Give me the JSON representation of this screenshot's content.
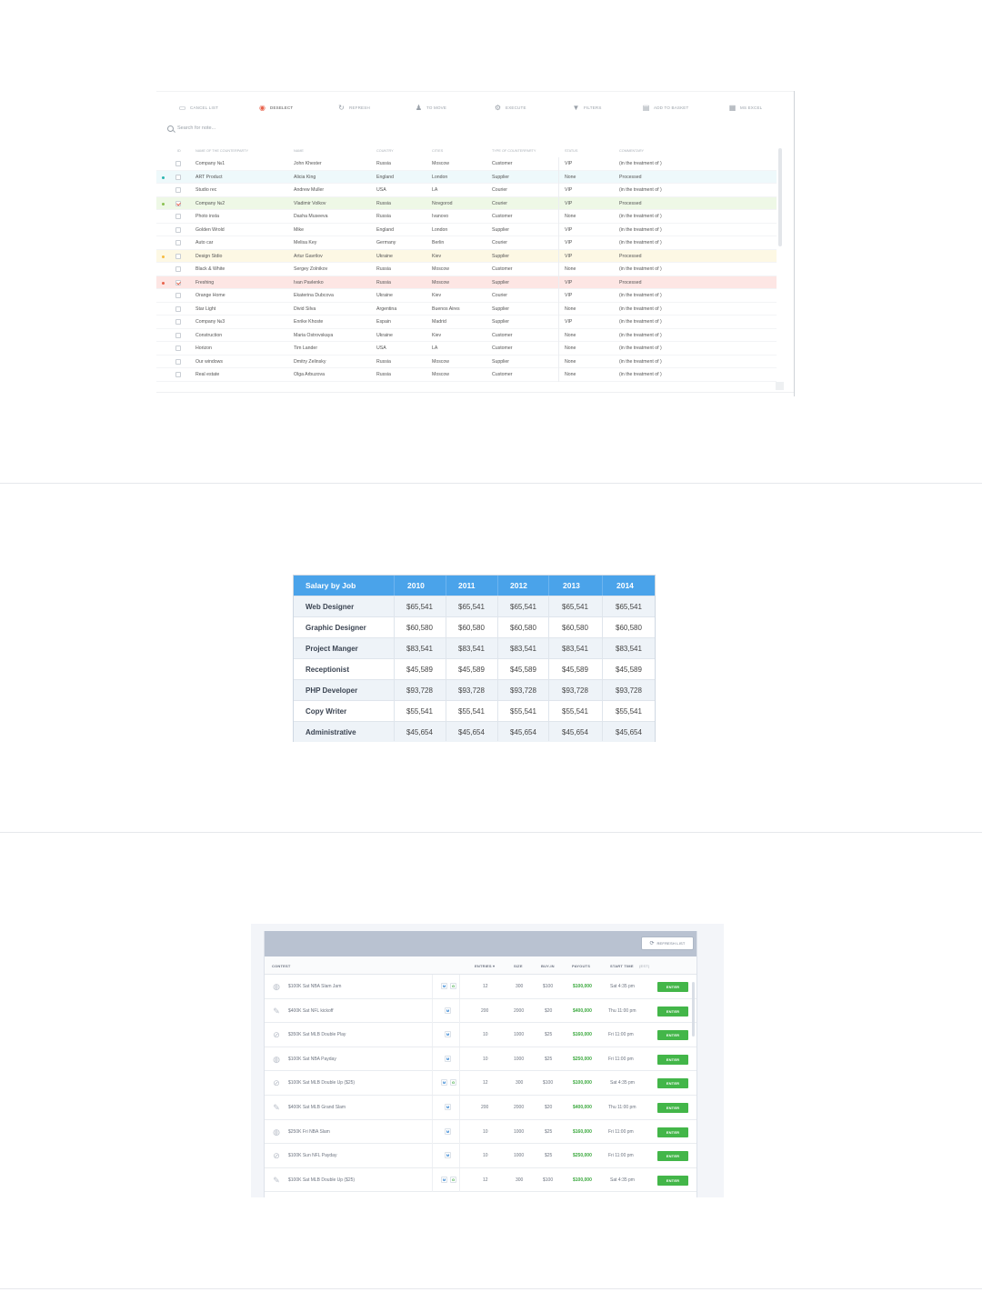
{
  "counterparties": {
    "toolbar": [
      {
        "icon": "document-icon",
        "label": "CANCEL LIST",
        "active": false
      },
      {
        "icon": "deselect-icon",
        "label": "DESELECT",
        "active": true
      },
      {
        "icon": "refresh-icon",
        "label": "REFRESH",
        "active": false
      },
      {
        "icon": "person-icon",
        "label": "TO MOVE",
        "active": false
      },
      {
        "icon": "gear-icon",
        "label": "EXECUTE",
        "active": false
      },
      {
        "icon": "filter-icon",
        "label": "FILTERS",
        "active": false
      },
      {
        "icon": "basket-icon",
        "label": "ADD TO BASKET",
        "active": false
      },
      {
        "icon": "excel-icon",
        "label": "MS EXCEL",
        "active": false
      }
    ],
    "search_placeholder": "Search for note...",
    "columns": [
      "ID",
      "NAME OF THE COUNTERPARTY",
      "NAME",
      "COUNTRY",
      "CITIES",
      "TYPE OF COUNTERPARTY",
      "STATUS",
      "COMMENTARY"
    ],
    "rows": [
      {
        "company": "Company №1",
        "name": "John Khester",
        "country": "Russia",
        "city": "Moscow",
        "type": "Customer",
        "status": "VIP",
        "comment": "(in the treatment of )",
        "checked": false,
        "marker": "",
        "highlight": ""
      },
      {
        "company": "ART Product",
        "name": "Alicia King",
        "country": "England",
        "city": "London",
        "type": "Supplier",
        "status": "None",
        "comment": "Processed",
        "checked": false,
        "marker": "#2bb5b0",
        "highlight": "#eef9fb"
      },
      {
        "company": "Studio rec",
        "name": "Andrew Muller",
        "country": "USA",
        "city": "LA",
        "type": "Courier",
        "status": "VIP",
        "comment": "(in the treatment of )",
        "checked": false,
        "marker": "",
        "highlight": ""
      },
      {
        "company": "Company №2",
        "name": "Vladimir Volkov",
        "country": "Russia",
        "city": "Novgorod",
        "type": "Courier",
        "status": "VIP",
        "comment": "Processed",
        "checked": true,
        "marker": "#8cc152",
        "highlight": "#eef8e6"
      },
      {
        "company": "Photo insta",
        "name": "Dasha Museeva",
        "country": "Russia",
        "city": "Ivanovo",
        "type": "Customer",
        "status": "None",
        "comment": "(in the treatment of )",
        "checked": false,
        "marker": "",
        "highlight": ""
      },
      {
        "company": "Golden Wrold",
        "name": "Mike",
        "country": "England",
        "city": "London",
        "type": "Supplier",
        "status": "VIP",
        "comment": "(in the treatment of )",
        "checked": false,
        "marker": "",
        "highlight": ""
      },
      {
        "company": "Auto car",
        "name": "Melisa Key",
        "country": "Germany",
        "city": "Berlin",
        "type": "Courier",
        "status": "VIP",
        "comment": "(in the treatment of )",
        "checked": false,
        "marker": "",
        "highlight": ""
      },
      {
        "company": "Design Stdio",
        "name": "Artur Gavrilov",
        "country": "Ukraine",
        "city": "Kiev",
        "type": "Supplier",
        "status": "VIP",
        "comment": "Processed",
        "checked": false,
        "marker": "#f6bb42",
        "highlight": "#fdf8e4"
      },
      {
        "company": "Black & White",
        "name": "Sergey Zolnikov",
        "country": "Russia",
        "city": "Moscow",
        "type": "Customer",
        "status": "None",
        "comment": "(in the treatment of )",
        "checked": false,
        "marker": "",
        "highlight": ""
      },
      {
        "company": "Freshing",
        "name": "Ivan Pavlenko",
        "country": "Russia",
        "city": "Moscow",
        "type": "Supplier",
        "status": "VIP",
        "comment": "Processed",
        "checked": true,
        "marker": "#e8624c",
        "highlight": "#fde6e4"
      },
      {
        "company": "Orange Home",
        "name": "Ekaterina Dubcova",
        "country": "Ukraine",
        "city": "Kiev",
        "type": "Courier",
        "status": "VIP",
        "comment": "(in the treatment of )",
        "checked": false,
        "marker": "",
        "highlight": ""
      },
      {
        "company": "Star Light",
        "name": "Divid Silva",
        "country": "Argentina",
        "city": "Buenos Aires",
        "type": "Supplier",
        "status": "None",
        "comment": "(in the treatment of )",
        "checked": false,
        "marker": "",
        "highlight": ""
      },
      {
        "company": "Company №3",
        "name": "Enrike Khoste",
        "country": "Espain",
        "city": "Madrid",
        "type": "Supplier",
        "status": "VIP",
        "comment": "(in the treatment of )",
        "checked": false,
        "marker": "",
        "highlight": ""
      },
      {
        "company": "Construction",
        "name": "Maria Ostrovskaya",
        "country": "Ukraine",
        "city": "Kiev",
        "type": "Customer",
        "status": "None",
        "comment": "(in the treatment of )",
        "checked": false,
        "marker": "",
        "highlight": ""
      },
      {
        "company": "Horizon",
        "name": "Tim Lander",
        "country": "USA",
        "city": "LA",
        "type": "Customer",
        "status": "None",
        "comment": "(in the treatment of )",
        "checked": false,
        "marker": "",
        "highlight": ""
      },
      {
        "company": "Our windows",
        "name": "Dmitry Zelinsky",
        "country": "Russia",
        "city": "Moscow",
        "type": "Supplier",
        "status": "None",
        "comment": "(in the treatment of )",
        "checked": false,
        "marker": "",
        "highlight": ""
      },
      {
        "company": "Real estate",
        "name": "Olga Arbuzova",
        "country": "Russia",
        "city": "Moscow",
        "type": "Customer",
        "status": "None",
        "comment": "(in the treatment of )",
        "checked": false,
        "marker": "",
        "highlight": ""
      }
    ]
  },
  "salary": {
    "header": "Salary by Job",
    "years": [
      "2010",
      "2011",
      "2012",
      "2013",
      "2014"
    ],
    "rows": [
      {
        "job": "Web Designer",
        "values": [
          "$65,541",
          "$65,541",
          "$65,541",
          "$65,541",
          "$65,541"
        ]
      },
      {
        "job": "Graphic Designer",
        "values": [
          "$60,580",
          "$60,580",
          "$60,580",
          "$60,580",
          "$60,580"
        ]
      },
      {
        "job": "Project Manger",
        "values": [
          "$83,541",
          "$83,541",
          "$83,541",
          "$83,541",
          "$83,541"
        ]
      },
      {
        "job": "Receptionist",
        "values": [
          "$45,589",
          "$45,589",
          "$45,589",
          "$45,589",
          "$45,589"
        ]
      },
      {
        "job": "PHP Developer",
        "values": [
          "$93,728",
          "$93,728",
          "$93,728",
          "$93,728",
          "$93,728"
        ]
      },
      {
        "job": "Copy Writer",
        "values": [
          "$55,541",
          "$55,541",
          "$55,541",
          "$55,541",
          "$55,541"
        ]
      },
      {
        "job": "Administrative",
        "values": [
          "$45,654",
          "$45,654",
          "$45,654",
          "$45,654",
          "$45,654"
        ]
      }
    ],
    "colors": {
      "header": "#4aa3ea",
      "stripe": "#eef3f8"
    }
  },
  "lobby": {
    "refresh_label": "REFRESH LIST",
    "columns": {
      "contest": "CONTEST",
      "entries": "ENTRIES ▾",
      "size": "SIZE",
      "buyin": "BUY-IN",
      "payouts": "PAYOUTS",
      "start": "START TIME",
      "tz": "(EST)"
    },
    "enter_label": "ENTER",
    "rows": [
      {
        "sport": "basketball-icon",
        "name": "$100K Sat NBA Slam Jam",
        "badges": [
          "M",
          "G"
        ],
        "entries": "12",
        "size": "300",
        "buyin": "$100",
        "payouts": "$100,000",
        "start": "Sat 4:35 pm"
      },
      {
        "sport": "football-icon",
        "name": "$400K Sat NFL kickoff",
        "badges": [
          "M"
        ],
        "entries": "200",
        "size": "2000",
        "buyin": "$20",
        "payouts": "$400,000",
        "start": "Thu 11:00 pm"
      },
      {
        "sport": "baseball-icon",
        "name": "$350K Sat MLB Double Play",
        "badges": [
          "M"
        ],
        "entries": "10",
        "size": "1000",
        "buyin": "$25",
        "payouts": "$160,000",
        "start": "Fri 11:00 pm"
      },
      {
        "sport": "basketball-icon",
        "name": "$100K Sat NBA Payday",
        "badges": [
          "M"
        ],
        "entries": "10",
        "size": "1000",
        "buyin": "$25",
        "payouts": "$250,000",
        "start": "Fri 11:00 pm"
      },
      {
        "sport": "baseball-icon",
        "name": "$100K Sat MLB Double Up ($25)",
        "badges": [
          "M",
          "G"
        ],
        "entries": "12",
        "size": "300",
        "buyin": "$100",
        "payouts": "$100,000",
        "start": "Sat 4:35 pm"
      },
      {
        "sport": "football-icon",
        "name": "$400K Sat MLB Grand Slam",
        "badges": [
          "M"
        ],
        "entries": "200",
        "size": "2000",
        "buyin": "$20",
        "payouts": "$400,000",
        "start": "Thu 11:00 pm"
      },
      {
        "sport": "basketball-icon",
        "name": "$250K Fri NBA Slam",
        "badges": [
          "M"
        ],
        "entries": "10",
        "size": "1000",
        "buyin": "$25",
        "payouts": "$160,000",
        "start": "Fri 11:00 pm"
      },
      {
        "sport": "baseball-icon",
        "name": "$100K Sun NFL Payday",
        "badges": [
          "M"
        ],
        "entries": "10",
        "size": "1000",
        "buyin": "$25",
        "payouts": "$250,000",
        "start": "Fri 11:00 pm"
      },
      {
        "sport": "football-icon",
        "name": "$100K Sat MLB Double Up ($25)",
        "badges": [
          "M",
          "G"
        ],
        "entries": "12",
        "size": "300",
        "buyin": "$100",
        "payouts": "$100,000",
        "start": "Sat 4:35 pm"
      }
    ],
    "colors": {
      "header_bar": "#b9c2d1",
      "enter": "#43b649",
      "payout": "#3aa83d"
    }
  }
}
